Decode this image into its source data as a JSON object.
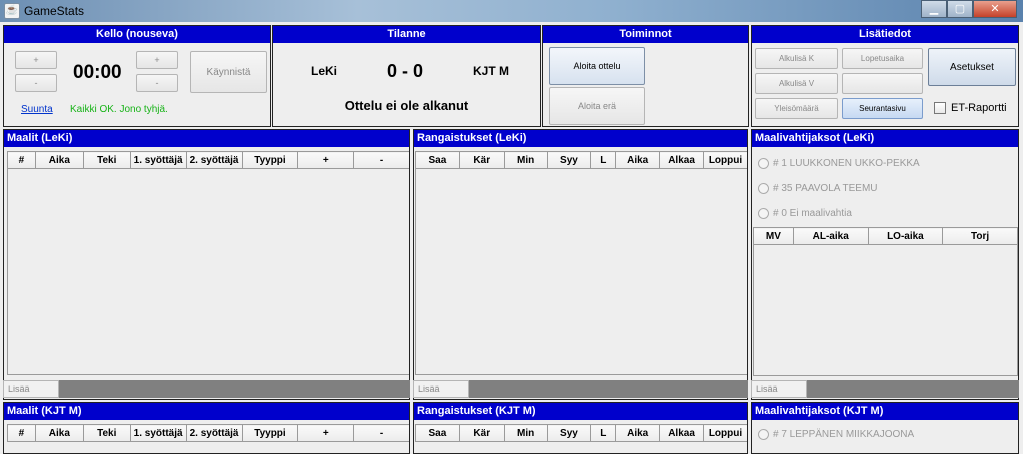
{
  "window": {
    "title": "GameStats",
    "app_icon": "java-cup-icon"
  },
  "clock": {
    "header": "Kello (nouseva)",
    "time": "00:00",
    "plus_label": "+",
    "minus_label": "-",
    "start_label": "Käynnistä",
    "direction_link": "Suunta",
    "status": "Kaikki OK. Jono tyhjä."
  },
  "situation": {
    "header": "Tilanne",
    "home_team": "LeKi",
    "away_team": "KJT M",
    "score": "0 - 0",
    "status": "Ottelu ei ole alkanut"
  },
  "actions": {
    "header": "Toiminnot",
    "start_match": "Aloita ottelu",
    "start_period": "Aloita erä"
  },
  "extra": {
    "header": "Lisätiedot",
    "start_time_k": "Alkulisä K",
    "end_time": "Lopetusaika",
    "settings": "Asetukset",
    "start_time_v": "Alkulisä V",
    "audience": "Yleisömäärä",
    "follow_page": "Seurantasivu",
    "et_report": "ET-Raportti"
  },
  "goals_home": {
    "header": "Maalit (LeKi)",
    "columns": [
      "#",
      "Aika",
      "Teki",
      "1. syöttäjä",
      "2. syöttäjä",
      "Tyyppi",
      "+",
      "-"
    ],
    "add_label": "Lisää"
  },
  "penalties_home": {
    "header": "Rangaistukset (LeKi)",
    "columns": [
      "Saa",
      "Kär",
      "Min",
      "Syy",
      "L",
      "Aika",
      "Alkaa",
      "Loppui"
    ],
    "add_label": "Lisää"
  },
  "goalie_home": {
    "header": "Maalivahtijaksot (LeKi)",
    "goalies": [
      "# 1 LUUKKONEN UKKO-PEKKA",
      "# 35 PAAVOLA TEEMU",
      "# 0 Ei maalivahtia"
    ],
    "columns": [
      "MV",
      "AL-aika",
      "LO-aika",
      "Torj"
    ],
    "add_label": "Lisää"
  },
  "goals_away": {
    "header": "Maalit (KJT M)",
    "columns": [
      "#",
      "Aika",
      "Teki",
      "1. syöttäjä",
      "2. syöttäjä",
      "Tyyppi",
      "+",
      "-"
    ]
  },
  "penalties_away": {
    "header": "Rangaistukset (KJT M)",
    "columns": [
      "Saa",
      "Kär",
      "Min",
      "Syy",
      "L",
      "Aika",
      "Alkaa",
      "Loppui"
    ]
  },
  "goalie_away": {
    "header": "Maalivahtijaksot (KJT M)",
    "goalies": [
      "# 7 LEPPÄNEN MIIKKAJOONA"
    ]
  },
  "colors": {
    "header_bg": "#0000cc",
    "status_ok": "#17b317",
    "link": "#0033cc"
  }
}
